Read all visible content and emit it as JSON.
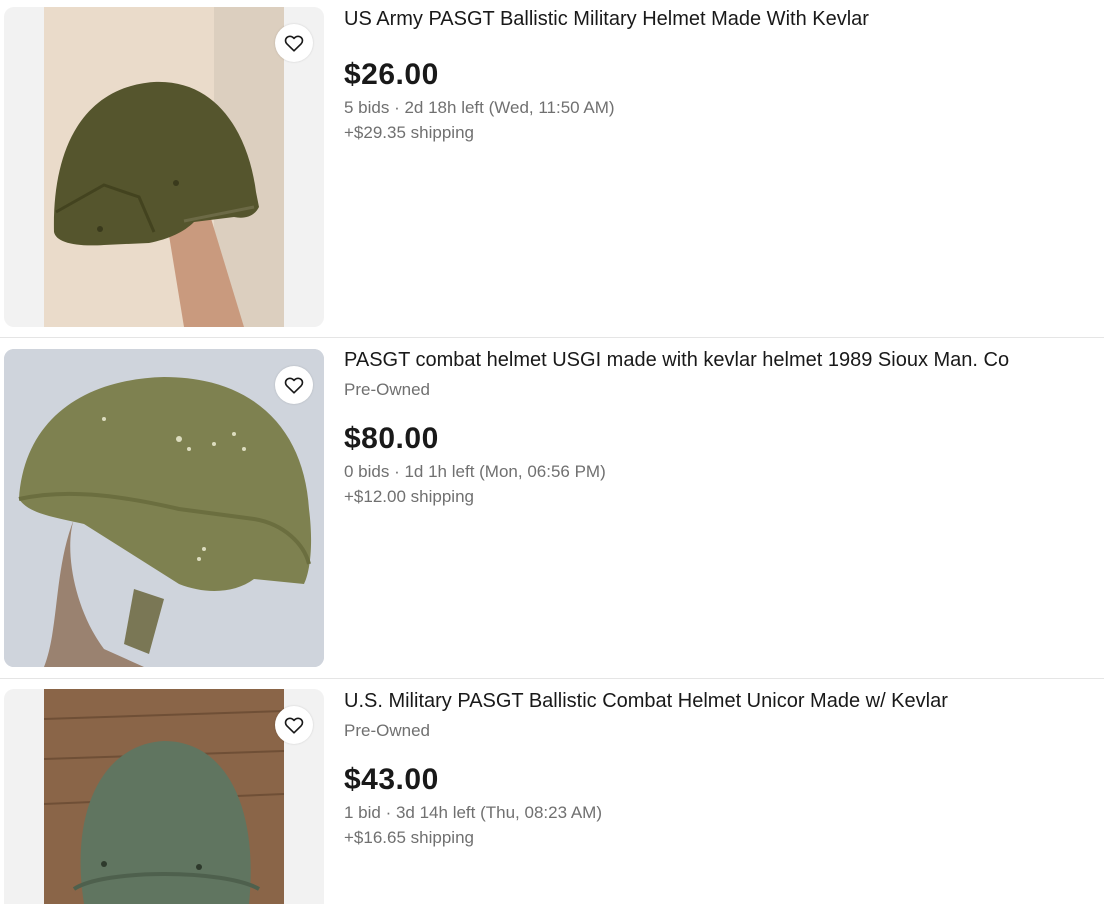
{
  "listings": [
    {
      "title": "US Army PASGT Ballistic Military Helmet Made With Kevlar",
      "condition": "",
      "price": "$26.00",
      "bids_line": "5 bids · 2d 18h left (Wed, 11:50 AM)",
      "shipping": "+$29.35 shipping"
    },
    {
      "title": "PASGT combat helmet USGI made with kevlar helmet 1989 Sioux Man. Co",
      "condition": "Pre-Owned",
      "price": "$80.00",
      "bids_line": "0 bids · 1d 1h left (Mon, 06:56 PM)",
      "shipping": "+$12.00 shipping"
    },
    {
      "title": "U.S. Military PASGT Ballistic Combat Helmet Unicor Made w/ Kevlar",
      "condition": "Pre-Owned",
      "price": "$43.00",
      "bids_line": "1 bid · 3d 14h left (Thu, 08:23 AM)",
      "shipping": "+$16.65 shipping"
    }
  ],
  "icons": {
    "watch": "heart-icon"
  },
  "colors": {
    "text_primary": "#191919",
    "text_secondary": "#707070",
    "divider": "#e5e5e5",
    "image_bg": "#f2f2f2"
  }
}
